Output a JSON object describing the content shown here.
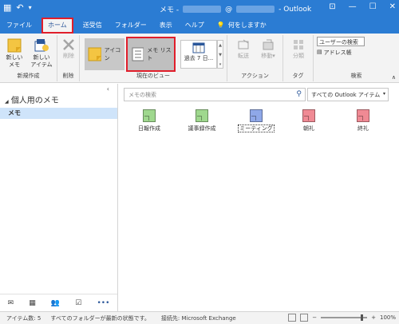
{
  "titlebar": {
    "title_prefix": "メモ -",
    "title_at": "@",
    "title_app": "- Outlook",
    "icons": [
      "outlook-icon",
      "undo-icon",
      "quick-access-dropdown-icon",
      "ribbon-display-icon",
      "minimize-icon",
      "maximize-icon",
      "close-icon"
    ]
  },
  "menu": {
    "tabs": [
      "ファイル",
      "ホーム",
      "送受信",
      "フォルダー",
      "表示",
      "ヘルプ"
    ],
    "active": "ホーム",
    "tell_me": "何をしますか"
  },
  "ribbon": {
    "new_note": "新しい\nメモ",
    "new_items": "新しい\nアイテム",
    "group_new": "新規作成",
    "delete": "削除",
    "group_delete": "削除",
    "view_icon": "アイコン",
    "view_list": "メモ リスト",
    "view_last7": "過去 7 日...",
    "group_view": "現在のビュー",
    "forward": "転送",
    "move": "移動",
    "group_action": "アクション",
    "categorize": "分類",
    "group_tags": "タグ",
    "search_people": "ユーザーの検索",
    "address_book": "アドレス帳",
    "group_find": "検索"
  },
  "nav": {
    "header": "個人用のメモ",
    "item": "メモ",
    "bottom_icons": [
      "mail-icon",
      "calendar-icon",
      "people-icon",
      "tasks-icon",
      "more-icon"
    ],
    "more_label": "•••"
  },
  "main": {
    "search_placeholder": "メモの検索",
    "scope": "すべての Outlook アイテム",
    "notes": [
      {
        "label": "日報作成",
        "color": "#9fd88e"
      },
      {
        "label": "議事録作成",
        "color": "#9fd88e"
      },
      {
        "label": "ミーティング",
        "color": "#8fa8e8"
      },
      {
        "label": "朝礼",
        "color": "#f08a94"
      },
      {
        "label": "終礼",
        "color": "#f08a94"
      }
    ]
  },
  "status": {
    "count": "アイテム数: 5",
    "folders": "すべてのフォルダーが最新の状態です。",
    "connection": "接続先: Microsoft Exchange",
    "zoom": "100%"
  }
}
